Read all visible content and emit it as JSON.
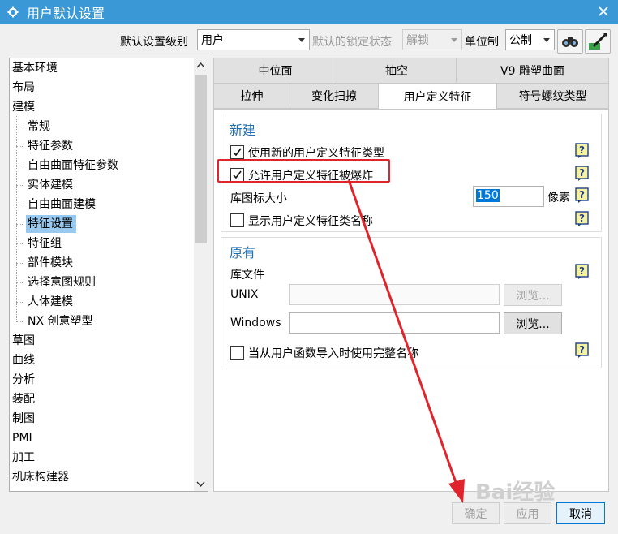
{
  "window": {
    "title": "用户默认设置"
  },
  "toolbar": {
    "default_level_label": "默认设置级别",
    "default_level_value": "用户",
    "lock_state_label": "默认的锁定状态",
    "lock_state_value": "解锁",
    "unit_label": "单位制",
    "unit_value": "公制"
  },
  "tree": {
    "items": [
      {
        "label": "基本环境",
        "level": 0
      },
      {
        "label": "布局",
        "level": 0
      },
      {
        "label": "建模",
        "level": 0
      },
      {
        "label": "常规",
        "level": 1
      },
      {
        "label": "特征参数",
        "level": 1
      },
      {
        "label": "自由曲面特征参数",
        "level": 1
      },
      {
        "label": "实体建模",
        "level": 1
      },
      {
        "label": "自由曲面建模",
        "level": 1
      },
      {
        "label": "特征设置",
        "level": 1,
        "selected": true
      },
      {
        "label": "特征组",
        "level": 1
      },
      {
        "label": "部件模块",
        "level": 1
      },
      {
        "label": "选择意图规则",
        "level": 1
      },
      {
        "label": "人体建模",
        "level": 1
      },
      {
        "label": "NX 创意塑型",
        "level": 1
      },
      {
        "label": "草图",
        "level": 0
      },
      {
        "label": "曲线",
        "level": 0
      },
      {
        "label": "分析",
        "level": 0
      },
      {
        "label": "装配",
        "level": 0
      },
      {
        "label": "制图",
        "level": 0
      },
      {
        "label": "PMI",
        "level": 0
      },
      {
        "label": "加工",
        "level": 0
      },
      {
        "label": "机床构建器",
        "level": 0
      }
    ]
  },
  "tabs": {
    "row1": [
      "中位面",
      "抽空",
      "V9 雕塑曲面"
    ],
    "row2": [
      "拉伸",
      "变化扫掠",
      "用户定义特征",
      "符号螺纹类型"
    ],
    "active": "用户定义特征"
  },
  "new_group": {
    "title": "新建",
    "use_new_type_label": "使用新的用户定义特征类型",
    "use_new_type_checked": true,
    "allow_explode_label": "允许用户定义特征被爆炸",
    "allow_explode_checked": true,
    "icon_size_label": "库图标大小",
    "icon_size_value": "150",
    "icon_size_unit": "像素",
    "show_name_label": "显示用户定义特征类名称",
    "show_name_checked": false
  },
  "existing_group": {
    "title": "原有",
    "library_label": "库文件",
    "unix_label": "UNIX",
    "unix_value": "",
    "windows_label": "Windows",
    "windows_value": "",
    "browse_label": "浏览...",
    "full_name_label": "当从用户函数导入时使用完整名称",
    "full_name_checked": false
  },
  "footer": {
    "ok_label": "确定",
    "apply_label": "应用",
    "cancel_label": "取消"
  },
  "watermark": {
    "text": "Bai经验"
  },
  "colors": {
    "titlebar": "#3b98d6",
    "selection": "#99c9ef",
    "annotation": "#e0242b",
    "group_title": "#1f6fb0"
  }
}
